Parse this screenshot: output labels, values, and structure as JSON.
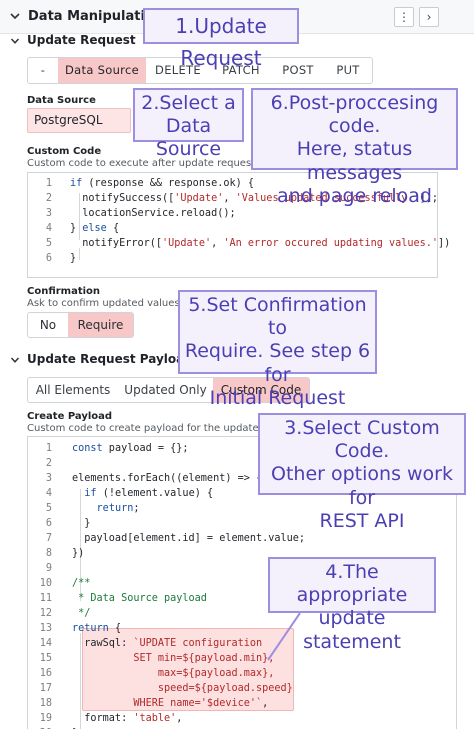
{
  "panel": {
    "title": "Data Manipulation",
    "more_icon": "⋮",
    "next_icon": "›"
  },
  "update_request": {
    "title": "Update Request",
    "methods": [
      "-",
      "Data Source",
      "DELETE",
      "PATCH",
      "POST",
      "PUT"
    ],
    "active_method": "Data Source",
    "data_source_label": "Data Source",
    "data_source_value": "PostgreSQL",
    "custom_code_label": "Custom Code",
    "custom_code_desc": "Custom code to execute after update request.",
    "code": [
      "if (response && response.ok) {",
      "  notifySuccess(['Update', 'Values updated successfully.']);",
      "  locationService.reload();",
      "} else {",
      "  notifyError(['Update', 'An error occured updating values.'])",
      "}"
    ],
    "confirmation_label": "Confirmation",
    "confirmation_desc": "Ask to confirm updated values.",
    "confirmation_options": [
      "No",
      "Require"
    ],
    "confirmation_active": "Require"
  },
  "update_payload": {
    "title": "Update Request Payload",
    "tabs": [
      "All Elements",
      "Updated Only",
      "Custom Code"
    ],
    "active_tab": "Custom Code",
    "create_payload_label": "Create Payload",
    "create_payload_desc": "Custom code to create payload for the update request.",
    "code": [
      "const payload = {};",
      "",
      "elements.forEach((element) => {",
      "  if (!element.value) {",
      "    return;",
      "  }",
      "  payload[element.id] = element.value;",
      "})",
      "",
      "/**",
      " * Data Source payload",
      " */",
      "return {",
      "  rawSql: `UPDATE configuration",
      "          SET min=${payload.min},",
      "              max=${payload.max},",
      "              speed=${payload.speed}",
      "          WHERE name='$device'`,",
      "  format: 'table',",
      "};"
    ]
  },
  "callouts": [
    [
      "1.Update Request"
    ],
    [
      "2.Select a",
      "Data Source"
    ],
    [
      "6.Post-proccesing code.",
      "Here, status messages",
      "and page reload"
    ],
    [
      "5.Set Confirmation to",
      "Require. See step 6 for",
      "Initial Request"
    ],
    [
      "3.Select Custom Code.",
      "Other options work for",
      "REST API"
    ],
    [
      "4.The appropriate",
      "update statement"
    ]
  ],
  "colors": {
    "accent_pink": "#f8c8c8",
    "callout_border": "#9c8fe0",
    "callout_text": "#4b3fb3",
    "keyword": "#1a4fa0",
    "string": "#b22a2a",
    "comment": "#1c7a3a"
  }
}
